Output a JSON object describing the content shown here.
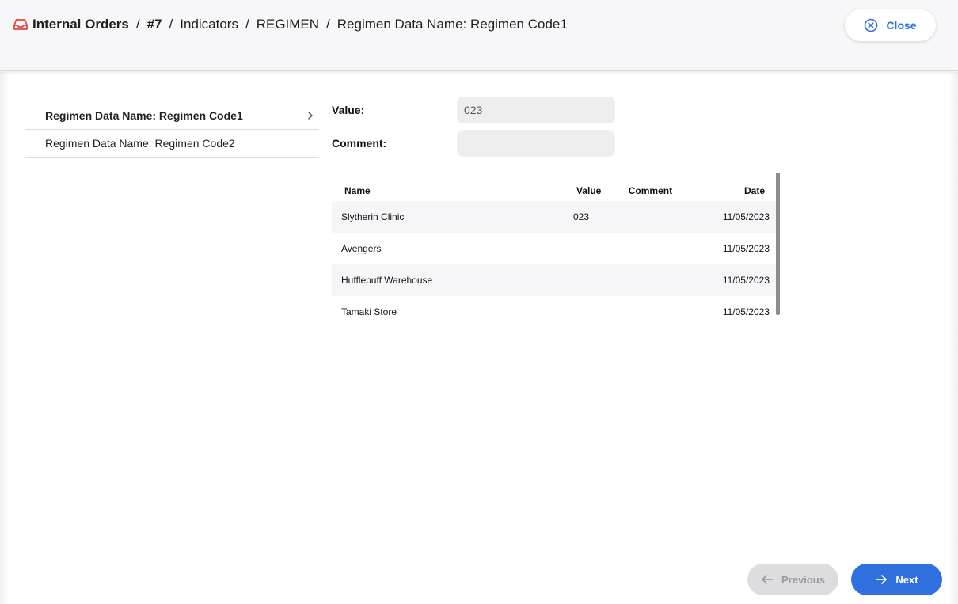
{
  "header": {
    "breadcrumb": {
      "root": "Internal Orders",
      "sep": "/",
      "order": "#7",
      "section": "Indicators",
      "group": "REGIMEN",
      "current": "Regimen Data Name: Regimen Code1"
    },
    "close_label": "Close",
    "icons": {
      "home": "inbox-tray-icon",
      "close": "close-circle-icon"
    }
  },
  "nav": {
    "items": [
      {
        "label": "Regimen Data Name: Regimen Code1",
        "active": true
      },
      {
        "label": "Regimen Data Name: Regimen Code2",
        "active": false
      }
    ]
  },
  "form": {
    "value_label": "Value:",
    "value": "023",
    "comment_label": "Comment:",
    "comment": ""
  },
  "table": {
    "headers": {
      "name": "Name",
      "value": "Value",
      "comment": "Comment",
      "date": "Date"
    },
    "rows": [
      {
        "name": "Slytherin Clinic",
        "value": "023",
        "comment": "",
        "date": "11/05/2023"
      },
      {
        "name": "Avengers",
        "value": "",
        "comment": "",
        "date": "11/05/2023"
      },
      {
        "name": "Hufflepuff Warehouse",
        "value": "",
        "comment": "",
        "date": "11/05/2023"
      },
      {
        "name": "Tamaki Store",
        "value": "",
        "comment": "",
        "date": "11/05/2023"
      }
    ]
  },
  "footer": {
    "previous_label": "Previous",
    "next_label": "Next"
  },
  "colors": {
    "accent": "#2f6fde",
    "brand_icon": "#e8453c",
    "header_bg": "#f7f7f9",
    "disabled_bg": "#dddde0"
  }
}
